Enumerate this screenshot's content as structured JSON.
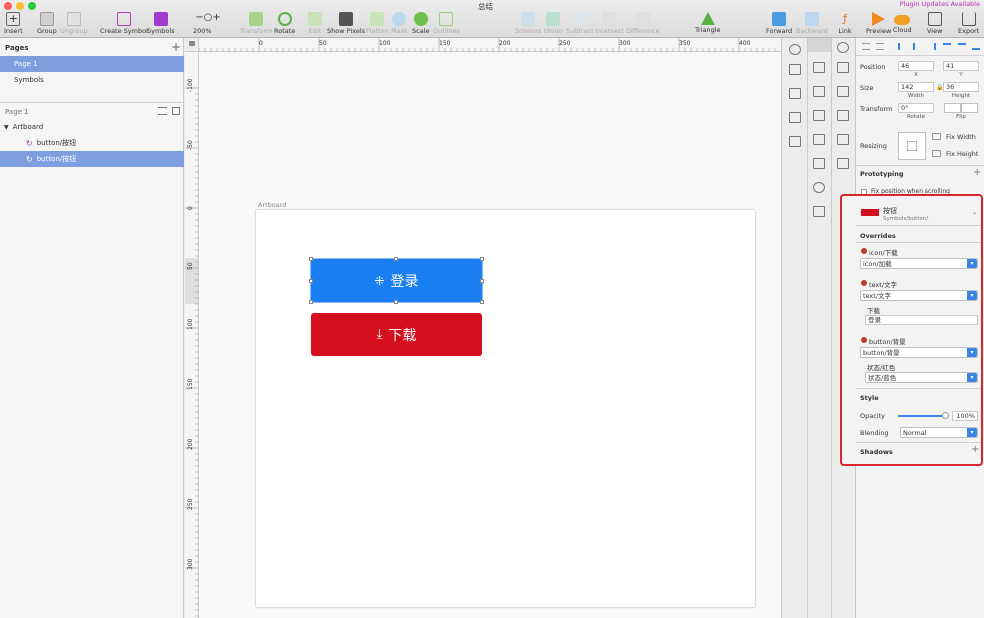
{
  "window": {
    "title": "总结",
    "plugin_updates": "Plugin Updates Available"
  },
  "toolbar": {
    "items": [
      {
        "label": "Insert",
        "enabled": true
      },
      {
        "label": "Group",
        "enabled": true
      },
      {
        "label": "Ungroup",
        "enabled": false
      },
      {
        "label": "Create Symbol",
        "enabled": true
      },
      {
        "label": "Symbols",
        "enabled": true
      },
      {
        "label": "200%",
        "enabled": true
      },
      {
        "label": "Transform",
        "enabled": false
      },
      {
        "label": "Rotate",
        "enabled": true
      },
      {
        "label": "Edit",
        "enabled": false
      },
      {
        "label": "Show Pixels",
        "enabled": true
      },
      {
        "label": "Flatten",
        "enabled": false
      },
      {
        "label": "Mask",
        "enabled": false
      },
      {
        "label": "Scale",
        "enabled": true
      },
      {
        "label": "Outlines",
        "enabled": false
      },
      {
        "label": "Scissors",
        "enabled": false
      },
      {
        "label": "Union",
        "enabled": false
      },
      {
        "label": "Subtract",
        "enabled": false
      },
      {
        "label": "Intersect",
        "enabled": false
      },
      {
        "label": "Difference",
        "enabled": false
      },
      {
        "label": "Triangle",
        "enabled": true
      },
      {
        "label": "Forward",
        "enabled": true
      },
      {
        "label": "Backward",
        "enabled": false
      },
      {
        "label": "Link",
        "enabled": true
      },
      {
        "label": "Preview",
        "enabled": true
      },
      {
        "label": "Cloud",
        "enabled": true
      },
      {
        "label": "View",
        "enabled": true
      },
      {
        "label": "Export",
        "enabled": true
      }
    ]
  },
  "pages_panel": {
    "header": "Pages",
    "add": "+",
    "pages": [
      "Page 1",
      "Symbols"
    ],
    "selected_index": 0
  },
  "layers_panel": {
    "page_header": "Page 1",
    "artboard": "Artboard",
    "layers": [
      "button/按钮",
      "button/按钮"
    ],
    "selected_index": 1
  },
  "rulers": {
    "horizontal": [
      "0",
      "50",
      "100",
      "150",
      "200",
      "250",
      "300",
      "350",
      "400"
    ],
    "vertical": [
      "-100",
      "-50",
      "0",
      "50",
      "100",
      "150",
      "200",
      "250",
      "300"
    ]
  },
  "canvas": {
    "artboard_label": "Artboard",
    "buttons": [
      {
        "icon": "loading-icon",
        "text": "登录",
        "color": "#1a7ff0"
      },
      {
        "icon": "download-icon",
        "text": "下载",
        "color": "#d4101e"
      }
    ]
  },
  "inspector": {
    "position": {
      "label": "Position",
      "x": "46",
      "y": "41",
      "x_caption": "X",
      "y_caption": "Y"
    },
    "size": {
      "label": "Size",
      "w": "142",
      "h": "36",
      "w_caption": "Width",
      "h_caption": "Height"
    },
    "transform": {
      "label": "Transform",
      "rotate": "0°",
      "rotate_caption": "Rotate",
      "flip_caption": "Flip"
    },
    "resizing": {
      "label": "Resizing",
      "fix_width": "Fix Width",
      "fix_height": "Fix Height"
    },
    "prototyping": {
      "label": "Prototyping",
      "fix_position": "Fix position when scrolling"
    },
    "symbol": {
      "name": "按钮",
      "path": "Symbols/button/",
      "swatch": "#d4101e"
    },
    "overrides": {
      "label": "Overrides",
      "groups": [
        {
          "title": "icon/下载",
          "value": "icon/加载"
        },
        {
          "title": "text/文字",
          "value": "text/文字",
          "subtitle": "下载",
          "text_value": "登录"
        },
        {
          "title": "button/背景",
          "value": "button/背景",
          "subtitle": "状态/红色",
          "sub_value": "状态/蓝色"
        }
      ]
    },
    "style": {
      "label": "Style",
      "opacity_label": "Opacity",
      "opacity_value": "100%",
      "opacity": 1.0,
      "blending_label": "Blending",
      "blending_value": "Normal"
    },
    "shadows": {
      "label": "Shadows",
      "add": "+"
    }
  },
  "colors": {
    "highlight_border": "#d9262c",
    "selection": "#7f9ee0",
    "accent_blue": "#3a84e8"
  }
}
